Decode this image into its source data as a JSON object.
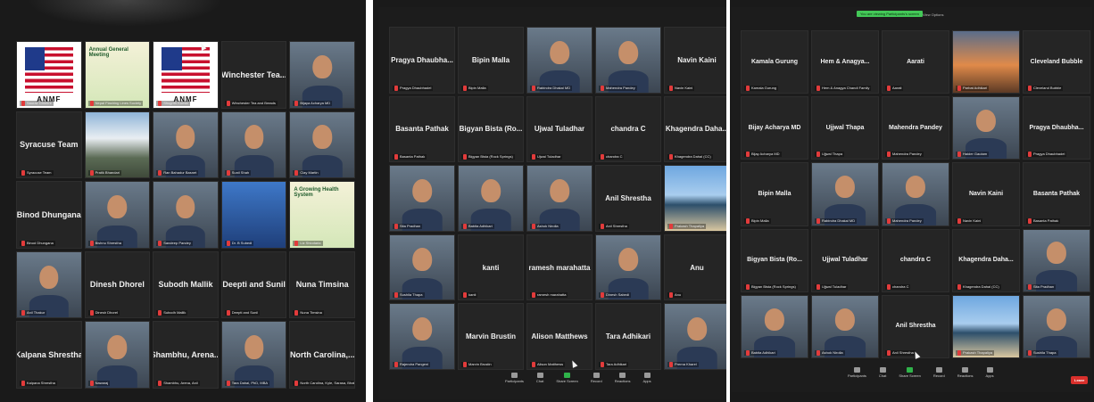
{
  "photos": [
    {
      "id": "left",
      "tiles": [
        {
          "name": "",
          "label": "Saurav Ghimire",
          "media": "flag",
          "media_text": "ANMF"
        },
        {
          "name": "",
          "label": "Nepal Flashing Lines Society",
          "media": "banner",
          "media_text": "Annual General Meeting"
        },
        {
          "name": "",
          "label": "Shugrith Kumar",
          "media": "flag",
          "media_text": "ANMF"
        },
        {
          "name": "Winchester Tea...",
          "label": "Winchester Tea and Breads",
          "media": "",
          "media_text": ""
        },
        {
          "name": "",
          "label": "Bijaya Acharya MD",
          "media": "person",
          "media_text": ""
        },
        {
          "name": "Syracuse Team",
          "label": "Syracuse Team",
          "media": "",
          "media_text": ""
        },
        {
          "name": "",
          "label": "Pratik Bhandari",
          "media": "mountain",
          "media_text": ""
        },
        {
          "name": "",
          "label": "Ran Bahadur Basnet",
          "media": "person",
          "media_text": ""
        },
        {
          "name": "",
          "label": "Sunil Shah",
          "media": "person",
          "media_text": ""
        },
        {
          "name": "",
          "label": "Clay Martin",
          "media": "person",
          "media_text": ""
        },
        {
          "name": "Binod Dhungana",
          "label": "Binod Dhungana",
          "media": "",
          "media_text": ""
        },
        {
          "name": "",
          "label": "Bishnu Shrestha",
          "media": "person",
          "media_text": ""
        },
        {
          "name": "",
          "label": "Sandeep Pandey",
          "media": "person",
          "media_text": ""
        },
        {
          "name": "",
          "label": "Dr. B Subedi",
          "media": "building",
          "media_text": ""
        },
        {
          "name": "",
          "label": "Liz Shiodaria",
          "media": "banner",
          "media_text": "A Growing Health System"
        },
        {
          "name": "",
          "label": "Anil Thakur",
          "media": "person",
          "media_text": ""
        },
        {
          "name": "Dinesh Dhorel",
          "label": "Dinesh Dhorel",
          "media": "",
          "media_text": ""
        },
        {
          "name": "Subodh Mallik",
          "label": "Subodh Mallik",
          "media": "",
          "media_text": ""
        },
        {
          "name": "Deepti and Sunil",
          "label": "Deepti and Sunil",
          "media": "",
          "media_text": ""
        },
        {
          "name": "Nuna Timsina",
          "label": "Nuna Timsina",
          "media": "",
          "media_text": ""
        },
        {
          "name": "Kalpana Shrestha",
          "label": "Kalpana Shrestha",
          "media": "",
          "media_text": ""
        },
        {
          "name": "",
          "label": "Nawaraj",
          "media": "person",
          "media_text": ""
        },
        {
          "name": "Shambhu, Arena...",
          "label": "Shambhu, Arena, Anil",
          "media": "",
          "media_text": ""
        },
        {
          "name": "",
          "label": "Tara Dahal, PhD, MBA",
          "media": "person",
          "media_text": ""
        },
        {
          "name": "North Carolina,...",
          "label": "North Carolina, Kyle, Sarasa, Bhattarai, Nisha",
          "media": "",
          "media_text": ""
        }
      ]
    },
    {
      "id": "middle",
      "tiles": [
        {
          "name": "Pragya Dhaubha...",
          "label": "Pragya Dhaubhadel",
          "media": "",
          "media_text": ""
        },
        {
          "name": "Bipin Malla",
          "label": "Bipin Malla",
          "media": "",
          "media_text": ""
        },
        {
          "name": "",
          "label": "Rabindra Dhakal MD",
          "media": "person",
          "media_text": ""
        },
        {
          "name": "",
          "label": "Mahendra Pandey",
          "media": "person",
          "media_text": ""
        },
        {
          "name": "Navin Kaini",
          "label": "Navin Kaini",
          "media": "",
          "media_text": ""
        },
        {
          "name": "Basanta Pathak",
          "label": "Basanta Pathak",
          "media": "",
          "media_text": ""
        },
        {
          "name": "Bigyan Bista (Ro...",
          "label": "Bigyan Bista (Rock Springs)",
          "media": "",
          "media_text": ""
        },
        {
          "name": "Ujwal Tuladhar",
          "label": "Ujwal Tuladhar",
          "media": "",
          "media_text": ""
        },
        {
          "name": "chandra C",
          "label": "chandra C",
          "media": "",
          "media_text": ""
        },
        {
          "name": "Khagendra Daha...",
          "label": "Khagendra Dahal (CC)",
          "media": "",
          "media_text": ""
        },
        {
          "name": "",
          "label": "Sita Pradhan",
          "media": "person",
          "media_text": ""
        },
        {
          "name": "",
          "label": "Babita Adhikari",
          "media": "person",
          "media_text": ""
        },
        {
          "name": "",
          "label": "Ashok Nirolla",
          "media": "person",
          "media_text": ""
        },
        {
          "name": "Anil Shrestha",
          "label": "Anil Shrestha",
          "media": "",
          "media_text": ""
        },
        {
          "name": "",
          "label": "Prakash Thapaliya",
          "media": "beach",
          "media_text": ""
        },
        {
          "name": "",
          "label": "Sushila Thapa",
          "media": "person",
          "media_text": ""
        },
        {
          "name": "kanti",
          "label": "kanti",
          "media": "",
          "media_text": ""
        },
        {
          "name": "ramesh marahatta",
          "label": "ramesh marahatta",
          "media": "",
          "media_text": ""
        },
        {
          "name": "",
          "label": "Dinesh Sabedi",
          "media": "person",
          "media_text": ""
        },
        {
          "name": "Anu",
          "label": "Anu",
          "media": "",
          "media_text": ""
        },
        {
          "name": "",
          "label": "Rajendra Pangeni",
          "media": "person",
          "media_text": ""
        },
        {
          "name": "Marvin Brustin",
          "label": "Marvin Brustin",
          "media": "",
          "media_text": ""
        },
        {
          "name": "Alison Matthews",
          "label": "Alison Matthews",
          "media": "",
          "media_text": ""
        },
        {
          "name": "Tara Adhikari",
          "label": "Tara Adhikari",
          "media": "",
          "media_text": ""
        },
        {
          "name": "",
          "label": "Prerna Kharel",
          "media": "person",
          "media_text": ""
        }
      ],
      "toolbar": [
        "Participants",
        "Chat",
        "Share Screen",
        "Record",
        "Reactions",
        "Apps"
      ]
    },
    {
      "id": "right",
      "top_status": "You are viewing Participants's screen",
      "top_name": "View Options",
      "tiles": [
        {
          "name": "Kamala Gurung",
          "label": "Kamala Gurung",
          "media": "",
          "media_text": ""
        },
        {
          "name": "Hem & Anagya...",
          "label": "Hem & Anagya Chandi Family",
          "media": "",
          "media_text": ""
        },
        {
          "name": "Aarati",
          "label": "Aarati",
          "media": "",
          "media_text": ""
        },
        {
          "name": "",
          "label": "Parbat Adhikari",
          "media": "sunset",
          "media_text": ""
        },
        {
          "name": "Cleveland Bubble",
          "label": "Cleveland Bubble",
          "media": "",
          "media_text": ""
        },
        {
          "name": "Bijay Acharya MD",
          "label": "Bijay Acharya MD",
          "media": "",
          "media_text": ""
        },
        {
          "name": "Ujjwal Thapa",
          "label": "Ujjwal Thapa",
          "media": "",
          "media_text": ""
        },
        {
          "name": "Mahendra Pandey",
          "label": "Mahendra Pandey",
          "media": "",
          "media_text": ""
        },
        {
          "name": "",
          "label": "Haider Gautam",
          "media": "person",
          "media_text": ""
        },
        {
          "name": "Pragya Dhaubha...",
          "label": "Pragya Dhaubhadel",
          "media": "",
          "media_text": ""
        },
        {
          "name": "Bipin Malla",
          "label": "Bipin Malla",
          "media": "",
          "media_text": ""
        },
        {
          "name": "",
          "label": "Rabindra Dhakal MD",
          "media": "person",
          "media_text": ""
        },
        {
          "name": "",
          "label": "Mahendra Pandey",
          "media": "person",
          "media_text": ""
        },
        {
          "name": "Navin Kaini",
          "label": "Navin Kaini",
          "media": "",
          "media_text": ""
        },
        {
          "name": "Basanta Pathak",
          "label": "Basanta Pathak",
          "media": "",
          "media_text": ""
        },
        {
          "name": "Bigyan Bista (Ro...",
          "label": "Bigyan Bista (Rock Springs)",
          "media": "",
          "media_text": ""
        },
        {
          "name": "Ujjwal Tuladhar",
          "label": "Ujjwal Tuladhar",
          "media": "",
          "media_text": ""
        },
        {
          "name": "chandra C",
          "label": "chandra C",
          "media": "",
          "media_text": ""
        },
        {
          "name": "Khagendra Daha...",
          "label": "Khagendra Dahal (CC)",
          "media": "",
          "media_text": ""
        },
        {
          "name": "",
          "label": "Sita Pradhan",
          "media": "person",
          "media_text": ""
        },
        {
          "name": "",
          "label": "Babita Adhikari",
          "media": "person",
          "media_text": ""
        },
        {
          "name": "",
          "label": "Ashok Nirolla",
          "media": "person",
          "media_text": ""
        },
        {
          "name": "Anil Shrestha",
          "label": "Anil Shrestha",
          "media": "",
          "media_text": ""
        },
        {
          "name": "",
          "label": "Prakash Thapaliya",
          "media": "beach",
          "media_text": ""
        },
        {
          "name": "",
          "label": "Sushila Thapa",
          "media": "person",
          "media_text": ""
        }
      ],
      "toolbar": [
        "Participants",
        "Chat",
        "Share Screen",
        "Record",
        "Reactions",
        "Apps"
      ],
      "leave_label": "Leave"
    }
  ],
  "colors": {
    "screen_bg": "#1c1c1c",
    "tile_bg": "#252525",
    "muted_mic": "#e23b3b",
    "share_green": "#2fb34a",
    "leave_red": "#d9302c"
  }
}
